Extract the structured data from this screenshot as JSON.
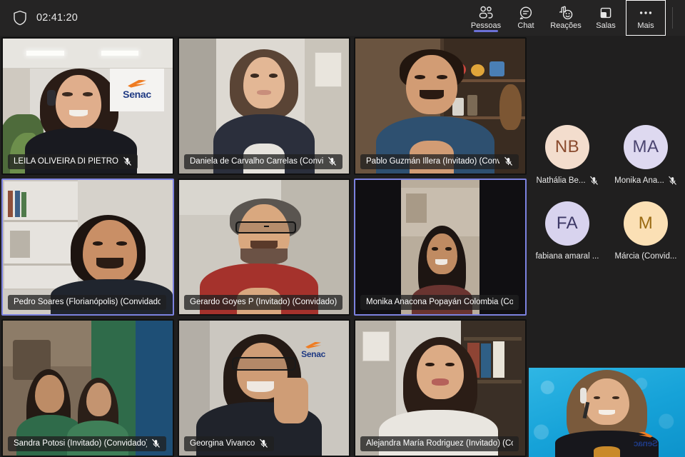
{
  "app": {
    "name": "video-meeting",
    "background": "#201f1f"
  },
  "topbar": {
    "shield_icon": "shield-icon",
    "timer": "02:41:20",
    "buttons": [
      {
        "id": "pessoas",
        "label": "Pessoas",
        "icon": "people-icon",
        "active": true,
        "focused": false
      },
      {
        "id": "chat",
        "label": "Chat",
        "icon": "chat-icon",
        "active": false,
        "focused": false
      },
      {
        "id": "reacoes",
        "label": "Reações",
        "icon": "reactions-icon",
        "active": false,
        "focused": false
      },
      {
        "id": "salas",
        "label": "Salas",
        "icon": "rooms-icon",
        "active": false,
        "focused": false
      },
      {
        "id": "mais",
        "label": "Mais",
        "icon": "more-icon",
        "active": false,
        "focused": true
      }
    ]
  },
  "grid": {
    "columns": 3,
    "rows": 3,
    "tiles": [
      {
        "name": "LEILA OLIVEIRA DI PIETRO",
        "muted": true,
        "speaking": false,
        "has_logo": true
      },
      {
        "name": "Daniela de Carvalho Carrelas (Convid...",
        "muted": true,
        "speaking": false,
        "has_logo": false
      },
      {
        "name": "Pablo Guzmán Illera (Invitado) (Convi...",
        "muted": true,
        "speaking": false,
        "has_logo": false
      },
      {
        "name": "Pedro Soares (Florianópolis) (Convidado)",
        "muted": false,
        "speaking": true,
        "has_logo": false
      },
      {
        "name": "Gerardo Goyes P (Invitado) (Convidado)",
        "muted": false,
        "speaking": false,
        "has_logo": false
      },
      {
        "name": "Monika Anacona Popayán Colombia (Co...",
        "muted": false,
        "speaking": true,
        "has_logo": false
      },
      {
        "name": "Sandra Potosi (Invitado) (Convidado)",
        "muted": true,
        "speaking": false,
        "has_logo": false
      },
      {
        "name": "Georgina Vivanco",
        "muted": true,
        "speaking": false,
        "has_logo": true
      },
      {
        "name": "Alejandra María Rodriguez (Invitado) (Co...",
        "muted": false,
        "speaking": false,
        "has_logo": false
      }
    ]
  },
  "right_panel": {
    "avatars": [
      {
        "initials": "NB",
        "name": "Nathália Be...",
        "muted": true,
        "bg": "#f3ddcd",
        "fg": "#8a4b2e"
      },
      {
        "initials": "MA",
        "name": "Monika Ana...",
        "muted": true,
        "bg": "#ded9f0",
        "fg": "#4b4570"
      },
      {
        "initials": "FA",
        "name": "fabiana amaral ...",
        "muted": false,
        "bg": "#d8d3ee",
        "fg": "#3d3866"
      },
      {
        "initials": "M",
        "name": "Márcia (Convid...",
        "muted": false,
        "bg": "#fbe0b5",
        "fg": "#9a6a12"
      }
    ],
    "self_view": {
      "label": "self-view",
      "brand": "Senac",
      "background_color": "#17a8dd"
    }
  },
  "colors": {
    "accent": "#6b71d6",
    "speaking_border": "#7c82e0",
    "panel_bg": "#201f1f",
    "topbar_bg": "#252424",
    "senac_blue": "#1f3a83",
    "senac_orange": "#ef7c22"
  }
}
